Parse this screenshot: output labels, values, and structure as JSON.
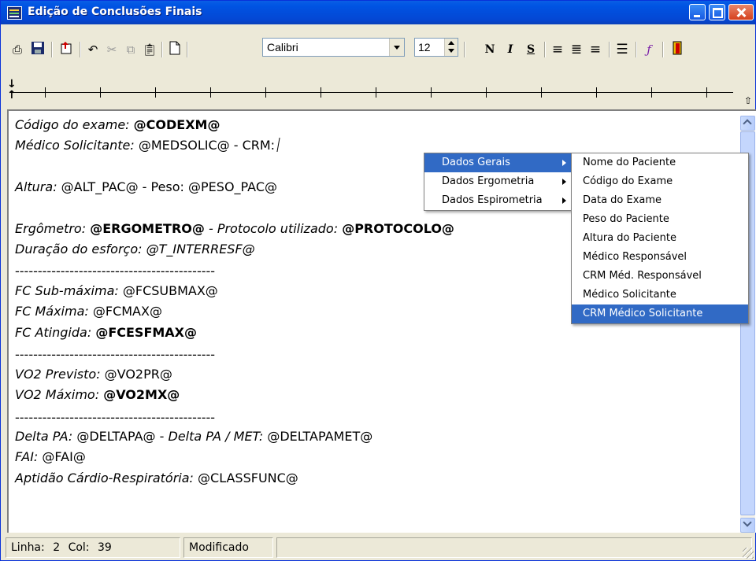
{
  "window": {
    "title": "Edição de Conclusões Finais"
  },
  "toolbar": {
    "font_name": "Calibri",
    "font_size": "12",
    "bold_label": "N",
    "italic_label": "I",
    "underline_label": "S"
  },
  "document": {
    "lines": [
      {
        "label": "Código do exame:",
        "value": "@CODEXM@"
      },
      {
        "label": "Médico Solicitante:",
        "value": "@MEDSOLIC@ - CRM:"
      },
      {
        "label": "Altura:",
        "value": "@ALT_PAC@ - Peso: @PESO_PAC@"
      },
      {
        "label": "Ergômetro:",
        "value": "@ERGOMETRO@",
        "label2": "- Protocolo utilizado:",
        "value2": "@PROTOCOLO@"
      },
      {
        "label": "Duração do esforço:",
        "value": "@T_INTERRESF@"
      },
      {
        "label": "--------------------------------------------"
      },
      {
        "label": "FC Sub-máxima:",
        "value": "@FCSUBMAX@"
      },
      {
        "label": "FC Máxima:",
        "value": "@FCMAX@"
      },
      {
        "label": "FC Atingida:",
        "value": "@FCESFMAX@"
      },
      {
        "label": "--------------------------------------------"
      },
      {
        "label": "VO2 Previsto:",
        "value": "@VO2PR@"
      },
      {
        "label": "VO2 Máximo:",
        "value": "@VO2MX@"
      },
      {
        "label": "--------------------------------------------"
      },
      {
        "label": "Delta PA:",
        "value": "@DELTAPA@ -",
        "label2": "Delta PA / MET:",
        "value2": "@DELTAPAMET@"
      },
      {
        "label": "FAI:",
        "value": "@FAI@"
      },
      {
        "label": "Aptidão Cárdio-Respiratória:",
        "value": "@CLASSFUNC@"
      }
    ]
  },
  "context_menu": {
    "items": [
      "Dados Gerais",
      "Dados Ergometria",
      "Dados Espirometria"
    ],
    "submenu": [
      "Nome do Paciente",
      "Código do Exame",
      "Data do Exame",
      "Peso do Paciente",
      "Altura do Paciente",
      "Médico Responsável",
      "CRM Méd. Responsável",
      "Médico Solicitante",
      "CRM Médico Solicitante"
    ]
  },
  "status": {
    "line_label": "Linha:",
    "line_value": "2",
    "col_label": "Col:",
    "col_value": "39",
    "state": "Modificado"
  },
  "colors": {
    "title_bar": "#0054e3",
    "menu_highlight": "#316ac5"
  },
  "icons": [
    "print-preview-icon",
    "save-icon",
    "insert-field-icon",
    "undo-icon",
    "cut-icon",
    "copy-icon",
    "paste-icon",
    "new-document-icon",
    "align-left-icon",
    "align-center-icon",
    "align-right-icon",
    "bullets-icon",
    "font-icon",
    "exit-icon"
  ]
}
